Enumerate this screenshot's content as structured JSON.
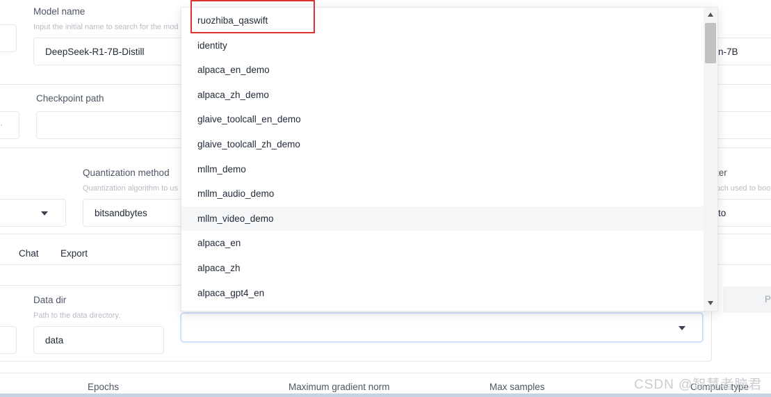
{
  "model": {
    "name_label": "Model name",
    "name_hint": "Input the initial name to search for the mod",
    "name_value": "DeepSeek-R1-7B-Distill",
    "right_value_fragment": "n-7B"
  },
  "checkpoint": {
    "label": "Checkpoint path",
    "value": ""
  },
  "quantization": {
    "label": "Quantization method",
    "hint": "Quantization algorithm to us",
    "value": "bitsandbytes",
    "right_label_fragment": "ter",
    "right_hint_fragment": "ach used to boo",
    "right_value_fragment": "to"
  },
  "tabs": [
    "Chat",
    "Export"
  ],
  "data_dir": {
    "label": "Data dir",
    "hint": "Path to the data directory.",
    "value": "data"
  },
  "preview_button_fragment": "P",
  "dataset_dropdown": {
    "options": [
      "ruozhiba_qaswift",
      "identity",
      "alpaca_en_demo",
      "alpaca_zh_demo",
      "glaive_toolcall_en_demo",
      "glaive_toolcall_zh_demo",
      "mllm_demo",
      "mllm_audio_demo",
      "mllm_video_demo",
      "alpaca_en",
      "alpaca_zh",
      "alpaca_gpt4_en"
    ],
    "hovered_option": "mllm_video_demo",
    "highlighted_option": "ruozhiba_qaswift"
  },
  "bottom_labels": {
    "epochs": "Epochs",
    "max_grad_norm": "Maximum gradient norm",
    "max_samples": "Max samples",
    "compute_type": "Compute type"
  },
  "watermark": "CSDN @智慧者脑君",
  "colors": {
    "highlight_border": "#e03131",
    "focus_border": "#bfdbfe"
  }
}
